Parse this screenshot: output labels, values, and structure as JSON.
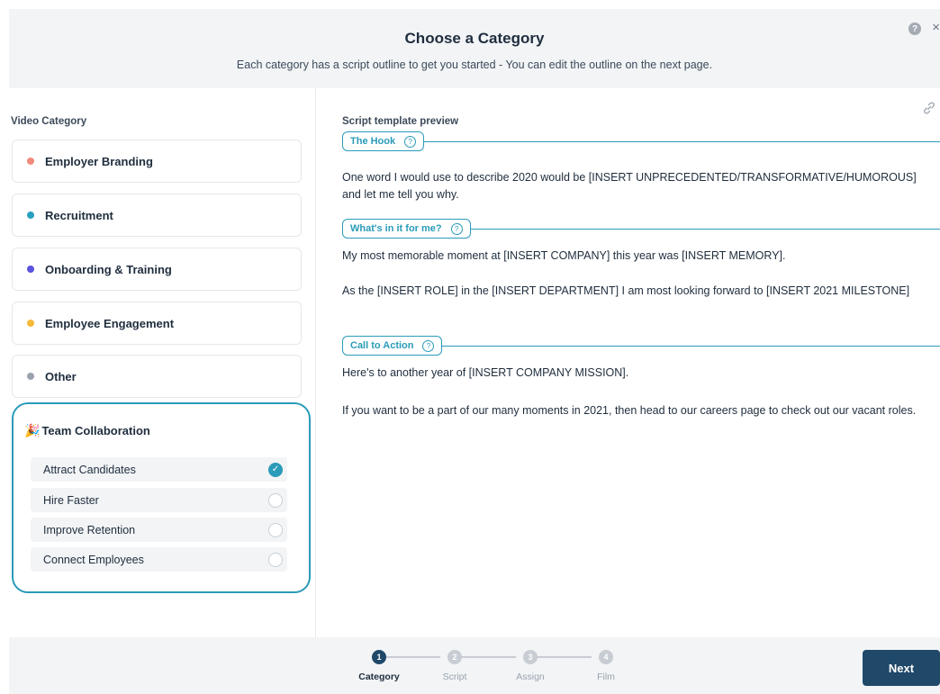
{
  "header": {
    "title": "Choose a Category",
    "subtitle": "Each category has a script outline to get you started - You can edit the outline on the next page."
  },
  "icons": {
    "help": "?",
    "close": "×"
  },
  "left": {
    "label": "Video Category",
    "categories": [
      {
        "label": "Employer Branding",
        "color": "#f08a7a"
      },
      {
        "label": "Recruitment",
        "color": "#2aa0c0"
      },
      {
        "label": "Onboarding & Training",
        "color": "#5a52e0"
      },
      {
        "label": "Employee Engagement",
        "color": "#f5b93a"
      },
      {
        "label": "Other",
        "color": "#9aa3ad"
      }
    ],
    "team": {
      "title": "Team Collaboration",
      "options": [
        {
          "label": "Attract Candidates",
          "checked": true
        },
        {
          "label": "Hire Faster",
          "checked": false
        },
        {
          "label": "Improve Retention",
          "checked": false
        },
        {
          "label": "Connect Employees",
          "checked": false
        }
      ]
    }
  },
  "right": {
    "label": "Script template preview",
    "sections": {
      "hook": "The Hook",
      "whats_in_it": "What's in it for me?",
      "cta": "Call to Action"
    },
    "paragraphs": {
      "hook_text": "One word I would use to describe 2020 would be [INSERT UNPRECEDENTED/TRANSFORMATIVE/HUMOROUS] and let me tell you why.",
      "memory": "My most memorable moment at [INSERT COMPANY] this year was [INSERT MEMORY].",
      "role": "As the [INSERT ROLE] in the [INSERT DEPARTMENT] I am most looking forward to [INSERT 2021 MILESTONE]",
      "mission": "Here's to another year of [INSERT COMPANY MISSION].",
      "careers": "If you want to be a part of our many moments in 2021, then head to our careers page to check out our vacant roles."
    }
  },
  "footer": {
    "steps": [
      {
        "num": "1",
        "label": "Category",
        "active": true
      },
      {
        "num": "2",
        "label": "Script",
        "active": false
      },
      {
        "num": "3",
        "label": "Assign",
        "active": false
      },
      {
        "num": "4",
        "label": "Film",
        "active": false
      }
    ],
    "next_label": "Next"
  },
  "colors": {
    "accent": "#2a9bb8",
    "primary": "#1f4869",
    "inactive": "#c8cdd3"
  }
}
